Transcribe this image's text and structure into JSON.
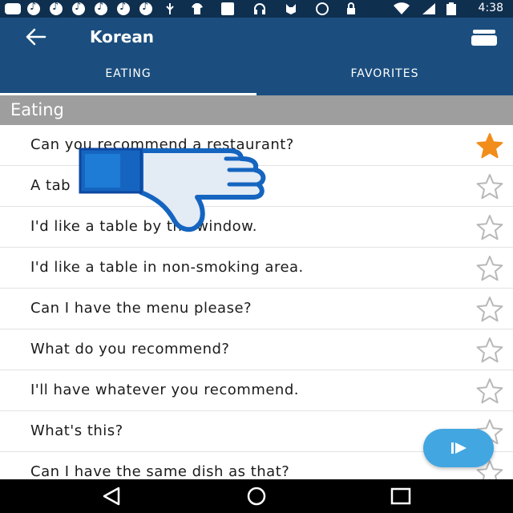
{
  "status_bar": {
    "time": "4:38",
    "icons": [
      "message-icon",
      "music-icon",
      "music-icon",
      "music-icon",
      "music-icon",
      "usb-icon",
      "shirt-icon",
      "news-icon",
      "headset-icon",
      "cat-icon",
      "record-icon",
      "lock-icon",
      "wifi-icon",
      "signal-icon",
      "battery-icon"
    ]
  },
  "app_bar": {
    "title": "Korean",
    "back_icon": "arrow-left-icon",
    "menu_icon": "stack-icon"
  },
  "tabs": [
    {
      "label": "EATING",
      "selected": true
    },
    {
      "label": "FAVORITES",
      "selected": false
    }
  ],
  "section": {
    "label": "Eating"
  },
  "items": [
    {
      "text": "Can you recommend a restaurant?",
      "favorite": true
    },
    {
      "text": "A tab",
      "favorite": false
    },
    {
      "text": "I'd like a table by the window.",
      "favorite": false
    },
    {
      "text": "I'd like a table in non-smoking area.",
      "favorite": false
    },
    {
      "text": "Can I have the menu please?",
      "favorite": false
    },
    {
      "text": "What do you recommend?",
      "favorite": false
    },
    {
      "text": "I'll have whatever you recommend.",
      "favorite": false
    },
    {
      "text": "What's this?",
      "favorite": false
    },
    {
      "text": "Can I have the same dish as that?",
      "favorite": false
    }
  ],
  "colors": {
    "status_bar": "#0f2f4f",
    "app_bar": "#1b4e7e",
    "section_header": "#9e9e9e",
    "star_active": "#f28c1a",
    "star_inactive": "#b8b8b8",
    "fab": "#42a6e1",
    "thumb_blue": "#1565c0"
  },
  "overlay": {
    "icon": "thumbs-down-icon"
  },
  "fab": {
    "icon": "play-icon"
  },
  "nav_bar": {
    "icons": [
      "back-triangle-icon",
      "home-circle-icon",
      "recents-square-icon"
    ]
  }
}
